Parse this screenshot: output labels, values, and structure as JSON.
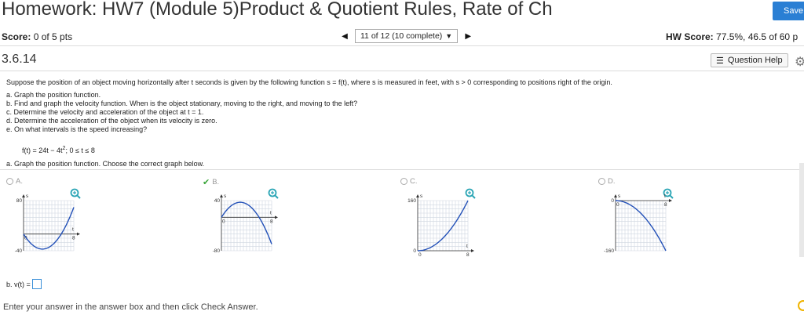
{
  "header": {
    "title": "Homework: HW7 (Module 5)Product & Quotient Rules, Rate of Ch",
    "save_label": "Save"
  },
  "score_row": {
    "score_label": "Score:",
    "score_value": "0 of 5 pts",
    "nav_text": "11 of 12 (10 complete)",
    "hw_score_label": "HW Score:",
    "hw_score_value": "77.5%, 46.5 of 60 p"
  },
  "question": {
    "number": "3.6.14",
    "help_label": "Question Help"
  },
  "problem": {
    "intro": "Suppose the position of an object moving horizontally after t seconds is given by the following function s = f(t), where s is measured in feet, with s > 0 corresponding to positions right of the origin.",
    "parts": [
      "a. Graph the position function.",
      "b. Find and graph the velocity function. When is the object stationary, moving to the right, and moving to the left?",
      "c. Determine the velocity and acceleration of the object at t = 1.",
      "d. Determine the acceleration of the object when its velocity is zero.",
      "e. On what intervals is the speed increasing?"
    ],
    "function_text": "f(t) = 24t − 4t",
    "function_exp": "2",
    "function_domain": "; 0 ≤ t ≤ 8"
  },
  "part_a": {
    "prompt": "a. Graph the position function. Choose the correct graph below.",
    "options": [
      {
        "letter": "A.",
        "selected": false,
        "ytop": "80",
        "ybottom": "-40",
        "xtick": "8",
        "taxis": "t",
        "saxis": "s",
        "zero": "0"
      },
      {
        "letter": "B.",
        "selected": true,
        "ytop": "40",
        "ybottom": "-80",
        "xtick": "8",
        "taxis": "t",
        "saxis": "s",
        "zero": "0"
      },
      {
        "letter": "C.",
        "selected": false,
        "ytop": "160",
        "ybottom": "0",
        "xtick": "8",
        "taxis": "t",
        "saxis": "s",
        "zero": "0"
      },
      {
        "letter": "D.",
        "selected": false,
        "ytop": "0",
        "ybottom": "-160",
        "xtick": "8",
        "taxis": "t",
        "saxis": "s",
        "zero": "0"
      }
    ]
  },
  "part_b": {
    "prompt": "b. v(t) ="
  },
  "footer": {
    "instruction": "Enter your answer in the answer box and then click Check Answer."
  },
  "colors": {
    "curve": "#2250b8",
    "accent": "#2a7fd4",
    "zoom": "#2aa5b5",
    "check": "#3aa53a"
  }
}
